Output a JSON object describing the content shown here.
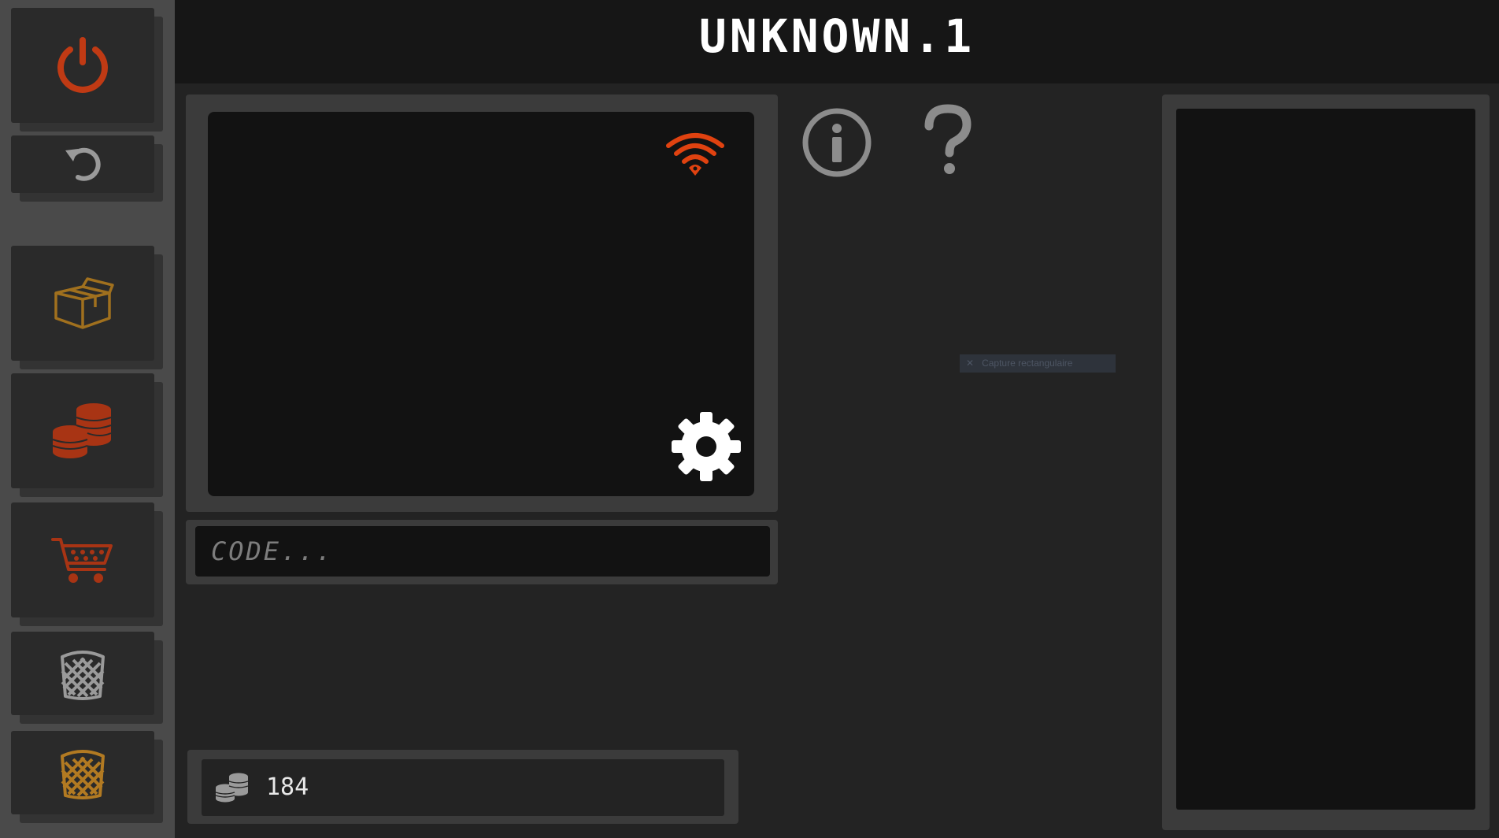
{
  "title": "UNKNOWN.1",
  "sidebar": {
    "buttons": [
      {
        "name": "power",
        "icon": "power-icon",
        "color": "#c03a14"
      },
      {
        "name": "undo",
        "icon": "undo-icon",
        "color": "#9a9a9a"
      },
      {
        "name": "inventory",
        "icon": "box-icon",
        "color": "#a0701e"
      },
      {
        "name": "coins",
        "icon": "coins-icon",
        "color": "#a83414"
      },
      {
        "name": "shop",
        "icon": "cart-icon",
        "color": "#a83414"
      },
      {
        "name": "trash-gray",
        "icon": "trash-icon",
        "color": "#9a9a9a"
      },
      {
        "name": "trash-gold",
        "icon": "trash-icon",
        "color": "#b27a22"
      }
    ]
  },
  "screen": {
    "wifi_icon": "wifi-icon",
    "wifi_color": "#e04210",
    "settings_icon": "gear-icon",
    "settings_color": "#ffffff"
  },
  "code_input": {
    "placeholder": "CODE...",
    "value": ""
  },
  "info": {
    "info_icon": "info-icon",
    "help_icon": "help-icon",
    "icon_color": "#8c8c8c"
  },
  "overlay": {
    "text": "Capture rectangulaire"
  },
  "coins": {
    "icon": "coins-icon",
    "count": "184"
  }
}
